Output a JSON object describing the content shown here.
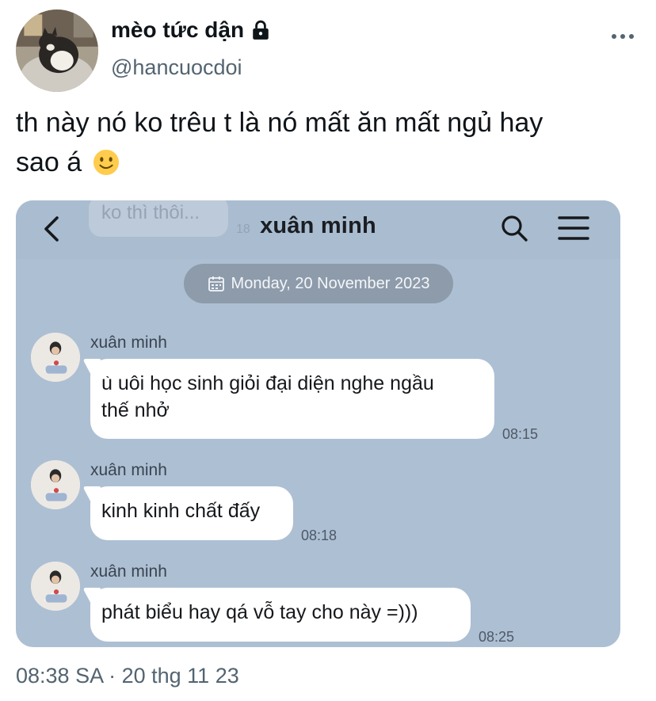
{
  "tweet": {
    "display_name": "mèo tức dận",
    "handle": "@hancuocdoi",
    "text_line1": "th này nó ko trêu t là nó mất ăn mất ngủ hay",
    "text_line2": "sao á",
    "emoji": "slightly-smiling-face",
    "timestamp": "08:38 SA · 20 thg 11 23",
    "icons": {
      "lock": "lock-icon",
      "more": "more-horizontal-icon"
    }
  },
  "chat": {
    "title": "xuân minh",
    "ghost_message": "ko thì thôi...",
    "ghost_time": "18",
    "date_label": "Monday, 20 November 2023",
    "messages": [
      {
        "sender": "xuân minh",
        "line1": "ù uôi học sinh giỏi đại diện nghe ngầu",
        "line2": "thế nhở",
        "time": "08:15"
      },
      {
        "sender": "xuân minh",
        "line1": "kinh kinh chất đấy",
        "line2": "",
        "time": "08:18"
      },
      {
        "sender": "xuân minh",
        "line1": "phát biểu hay qá vỗ tay cho này =)))",
        "line2": "",
        "time": "08:25"
      }
    ],
    "icons": {
      "back": "chevron-left-icon",
      "search": "search-icon",
      "menu": "hamburger-menu-icon",
      "calendar": "calendar-icon"
    },
    "colors": {
      "background": "#adbfd3",
      "date_pill": "#8d9bab",
      "bubble": "#ffffff"
    }
  }
}
